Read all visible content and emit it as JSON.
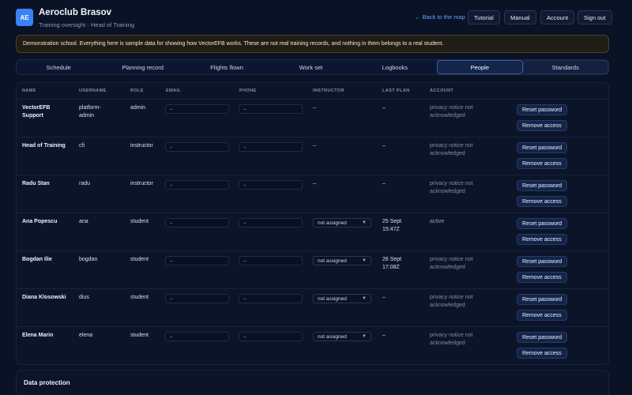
{
  "app": {
    "logo": "AE",
    "title": "Aeroclub Brasov",
    "subtitle": "Training oversight · Head of Training"
  },
  "header": {
    "back_link": "← Back to the map",
    "buttons": [
      "Tutorial",
      "Manual",
      "Account",
      "Sign out"
    ]
  },
  "notice": "Demonstration school. Everything here is sample data for showing how VectorEFB works. These are not real training records, and nothing in them belongs to a real student.",
  "tabs": [
    "Schedule",
    "Planning record",
    "Flights flown",
    "Work set",
    "Logbooks",
    "People",
    "Standards"
  ],
  "active_tab": "People",
  "people": {
    "columns": [
      "NAME",
      "USERNAME",
      "ROLE",
      "EMAIL",
      "PHONE",
      "INSTRUCTOR",
      "LAST PLAN",
      "ACCOUNT"
    ],
    "placeholder": "–",
    "reset_label": "Reset password",
    "remove_label": "Remove access",
    "rows": [
      {
        "name": "VectorEFB Support",
        "username": "platform-admin",
        "role": "admin",
        "instructor": "–",
        "last_plan": "–",
        "account": "privacy notice not acknowledged"
      },
      {
        "name": "Head of Training",
        "username": "cfi",
        "role": "instructor",
        "instructor": "–",
        "last_plan": "–",
        "account": "privacy notice not acknowledged"
      },
      {
        "name": "Radu Stan",
        "username": "radu",
        "role": "instructor",
        "instructor": "–",
        "last_plan": "–",
        "account": "privacy notice not acknowledged"
      },
      {
        "name": "Ana Popescu",
        "username": "ana",
        "role": "student",
        "instructor": "not assigned",
        "last_plan": "25 Sept 15:47Z",
        "account": "active"
      },
      {
        "name": "Bogdan Ilie",
        "username": "bogdan",
        "role": "student",
        "instructor": "not assigned",
        "last_plan": "26 Sept 17:08Z",
        "account": "privacy notice not acknowledged"
      },
      {
        "name": "Diana Klosowski",
        "username": "dius",
        "role": "student",
        "instructor": "not assigned",
        "last_plan": "–",
        "account": "privacy notice not acknowledged"
      },
      {
        "name": "Elena Marin",
        "username": "elena",
        "role": "student",
        "instructor": "not assigned",
        "last_plan": "–",
        "account": "privacy notice not acknowledged"
      }
    ]
  },
  "data_protection": {
    "title": "Data protection"
  },
  "colors": {
    "accent": "#3b82f6",
    "background": "#0a1226",
    "link": "#6aa2ff"
  }
}
